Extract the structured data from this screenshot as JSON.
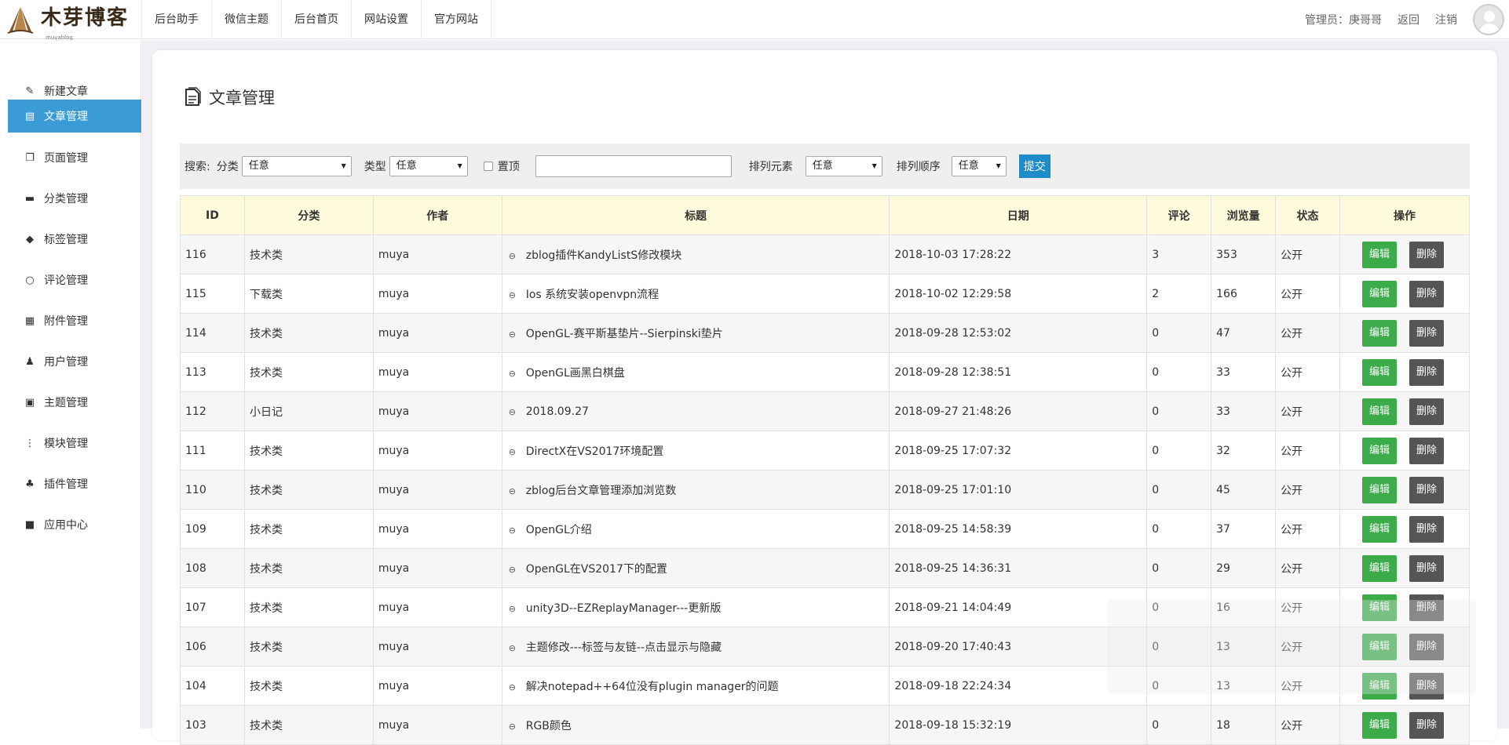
{
  "brand": {
    "name": "木芽博客",
    "sub": "muyablog"
  },
  "topnav": [
    "后台助手",
    "微信主题",
    "后台首页",
    "网站设置",
    "官方网站"
  ],
  "user": {
    "label": "管理员：庚哥哥",
    "back": "返回",
    "logout": "注销"
  },
  "sidebar": {
    "items": [
      {
        "label": "新建文章",
        "icon": "edit-icon"
      },
      {
        "label": "文章管理",
        "icon": "document-icon"
      },
      {
        "label": "页面管理",
        "icon": "pages-icon"
      },
      {
        "label": "分类管理",
        "icon": "folder-icon"
      },
      {
        "label": "标签管理",
        "icon": "tag-icon"
      },
      {
        "label": "评论管理",
        "icon": "comment-icon"
      },
      {
        "label": "附件管理",
        "icon": "attachment-icon"
      },
      {
        "label": "用户管理",
        "icon": "user-icon"
      },
      {
        "label": "主题管理",
        "icon": "theme-icon"
      },
      {
        "label": "模块管理",
        "icon": "module-icon"
      },
      {
        "label": "插件管理",
        "icon": "plugin-icon"
      },
      {
        "label": "应用中心",
        "icon": "app-center-icon"
      }
    ],
    "active_index": 1,
    "active_color": "#3a9bd5"
  },
  "page": {
    "title": "文章管理"
  },
  "search": {
    "label": "搜索:",
    "category_label": "分类",
    "category_value": "任意",
    "type_label": "类型",
    "type_value": "任意",
    "top_label": "置顶",
    "keyword_value": "",
    "sort_field_label": "排列元素",
    "sort_field_value": "任意",
    "sort_order_label": "排列顺序",
    "sort_order_value": "任意",
    "submit_label": "提交"
  },
  "table": {
    "headers": [
      "ID",
      "分类",
      "作者",
      "标题",
      "日期",
      "评论",
      "浏览量",
      "状态",
      "操作"
    ],
    "edit_label": "编辑",
    "delete_label": "删除",
    "rows": [
      {
        "id": "116",
        "category": "技术类",
        "author": "muya",
        "title": "zblog插件KandyListS修改模块",
        "date": "2018-10-03 17:28:22",
        "comments": "3",
        "views": "353",
        "status": "公开"
      },
      {
        "id": "115",
        "category": "下载类",
        "author": "muya",
        "title": "Ios 系统安装openvpn流程",
        "date": "2018-10-02 12:29:58",
        "comments": "2",
        "views": "166",
        "status": "公开"
      },
      {
        "id": "114",
        "category": "技术类",
        "author": "muya",
        "title": "OpenGL-赛平斯基垫片--Sierpinski垫片",
        "date": "2018-09-28 12:53:02",
        "comments": "0",
        "views": "47",
        "status": "公开"
      },
      {
        "id": "113",
        "category": "技术类",
        "author": "muya",
        "title": "OpenGL画黑白棋盘",
        "date": "2018-09-28 12:38:51",
        "comments": "0",
        "views": "33",
        "status": "公开"
      },
      {
        "id": "112",
        "category": "小日记",
        "author": "muya",
        "title": "2018.09.27",
        "date": "2018-09-27 21:48:26",
        "comments": "0",
        "views": "33",
        "status": "公开"
      },
      {
        "id": "111",
        "category": "技术类",
        "author": "muya",
        "title": "DirectX在VS2017环境配置",
        "date": "2018-09-25 17:07:32",
        "comments": "0",
        "views": "32",
        "status": "公开"
      },
      {
        "id": "110",
        "category": "技术类",
        "author": "muya",
        "title": "zblog后台文章管理添加浏览数",
        "date": "2018-09-25 17:01:10",
        "comments": "0",
        "views": "45",
        "status": "公开"
      },
      {
        "id": "109",
        "category": "技术类",
        "author": "muya",
        "title": "OpenGL介绍",
        "date": "2018-09-25 14:58:39",
        "comments": "0",
        "views": "37",
        "status": "公开"
      },
      {
        "id": "108",
        "category": "技术类",
        "author": "muya",
        "title": "OpenGL在VS2017下的配置",
        "date": "2018-09-25 14:36:31",
        "comments": "0",
        "views": "29",
        "status": "公开"
      },
      {
        "id": "107",
        "category": "技术类",
        "author": "muya",
        "title": "unity3D--EZReplayManager---更新版",
        "date": "2018-09-21 14:04:49",
        "comments": "0",
        "views": "16",
        "status": "公开"
      },
      {
        "id": "106",
        "category": "技术类",
        "author": "muya",
        "title": "主题修改---标签与友链--点击显示与隐藏",
        "date": "2018-09-20 17:40:43",
        "comments": "0",
        "views": "13",
        "status": "公开"
      },
      {
        "id": "104",
        "category": "技术类",
        "author": "muya",
        "title": "解决notepad++64位没有plugin manager的问题",
        "date": "2018-09-18 22:24:34",
        "comments": "0",
        "views": "13",
        "status": "公开"
      },
      {
        "id": "103",
        "category": "技术类",
        "author": "muya",
        "title": "RGB颜色",
        "date": "2018-09-18 15:32:19",
        "comments": "0",
        "views": "18",
        "status": "公开"
      }
    ]
  },
  "colors": {
    "edit": "#3cab4a",
    "delete": "#555555",
    "submit": "#1e8cc8",
    "header_bg": "#fffbdc"
  }
}
